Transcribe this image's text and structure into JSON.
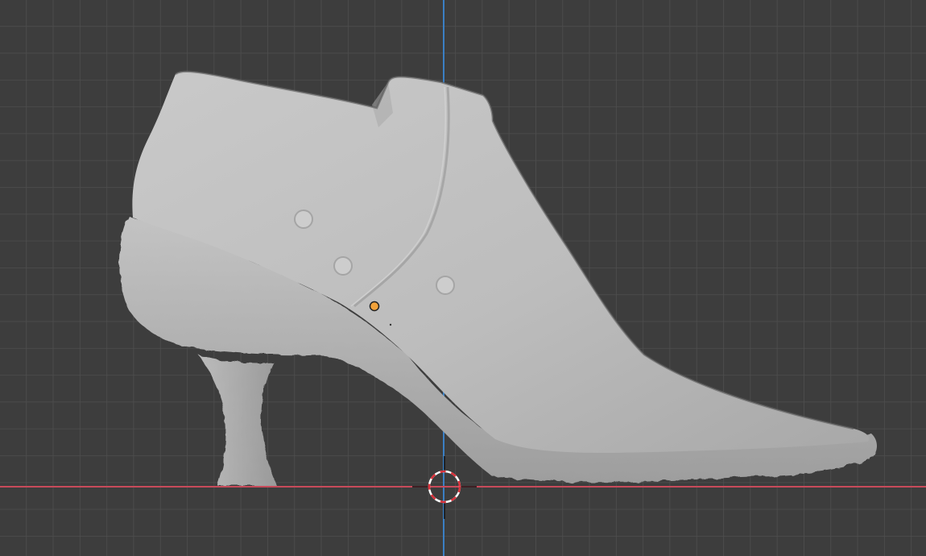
{
  "viewport": {
    "view": "right-orthographic",
    "mode": "sculpt-mode",
    "grid_visible": true,
    "colors": {
      "background": "#3d3d3d",
      "grid_line": "#4e4e4e",
      "x_axis": "#c84a5a",
      "z_axis": "#3a7fc4",
      "mesh": "#bdbdbd",
      "origin": "#f2a23a",
      "cursor_red": "#d9303a",
      "cursor_white": "#ffffff"
    }
  },
  "object": {
    "icon": "high-heel-ankle-boot-mesh"
  }
}
